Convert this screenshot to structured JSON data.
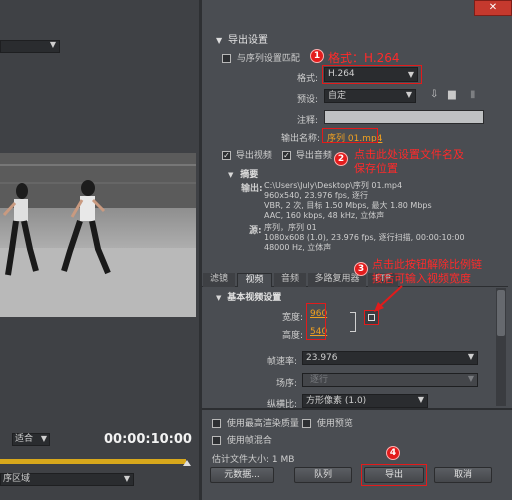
{
  "left": {
    "preview_dropdown": "",
    "fit_label": "适合",
    "timecode": "00:00:10:00",
    "bottom_dropdown_partial": "序区域"
  },
  "window": {
    "close": "✕"
  },
  "export": {
    "section_title": "导出设置",
    "match_sequence": "与序列设置匹配",
    "format_label": "格式:",
    "format_value": "H.264",
    "preset_label": "预设:",
    "preset_value": "自定",
    "comment_label": "注释:",
    "output_name_label": "输出名称:",
    "output_name_value": "序列 01.mp4",
    "export_video": "导出视频",
    "export_audio": "导出音频"
  },
  "summary": {
    "title": "摘要",
    "output_key": "输出:",
    "output_lines": [
      "C:\\Users\\July\\Desktop\\序列 01.mp4",
      "960x540, 23.976 fps, 逐行",
      "VBR, 2 次, 目标 1.50 Mbps, 最大 1.80 Mbps",
      "AAC, 160 kbps, 48 kHz, 立体声"
    ],
    "source_key": "源:",
    "source_lines": [
      "序列，序列 01",
      "1080x608 (1.0), 23.976 fps, 逐行扫描, 00:00:10:00",
      "48000 Hz, 立体声"
    ]
  },
  "tabs": [
    "滤镜",
    "视频",
    "音频",
    "多路复用器",
    "FTP"
  ],
  "video": {
    "section_title": "基本视频设置",
    "width_label": "宽度:",
    "width_value": "960",
    "height_label": "高度:",
    "height_value": "540",
    "framerate_label": "帧速率:",
    "framerate_value": "23.976",
    "field_order_label": "场序:",
    "field_order_value": "逐行",
    "aspect_label": "纵横比:",
    "aspect_value": "方形像素 (1.0)"
  },
  "bottom": {
    "max_render": "使用最高渲染质量",
    "use_preview": "使用预览",
    "frame_blend": "使用帧混合",
    "filesize": "估计文件大小: 1 MB",
    "metadata_btn": "元数据...",
    "queue_btn": "队列",
    "export_btn": "导出",
    "cancel_btn": "取消"
  },
  "annotations": {
    "n1": "1",
    "n1_text": "格式：H.264",
    "n2": "2",
    "n2_text_line1": "点击此处设置文件名及",
    "n2_text_line2": "保存位置",
    "n3": "3",
    "n3_text_line1": "点击此按钮解除比例链",
    "n3_text_line2": "接后可输入视频宽度",
    "n4": "4"
  },
  "colors": {
    "annotation_red": "#e21b1b",
    "value_orange": "#f0a020",
    "timeline_yellow": "#d8a81c"
  }
}
